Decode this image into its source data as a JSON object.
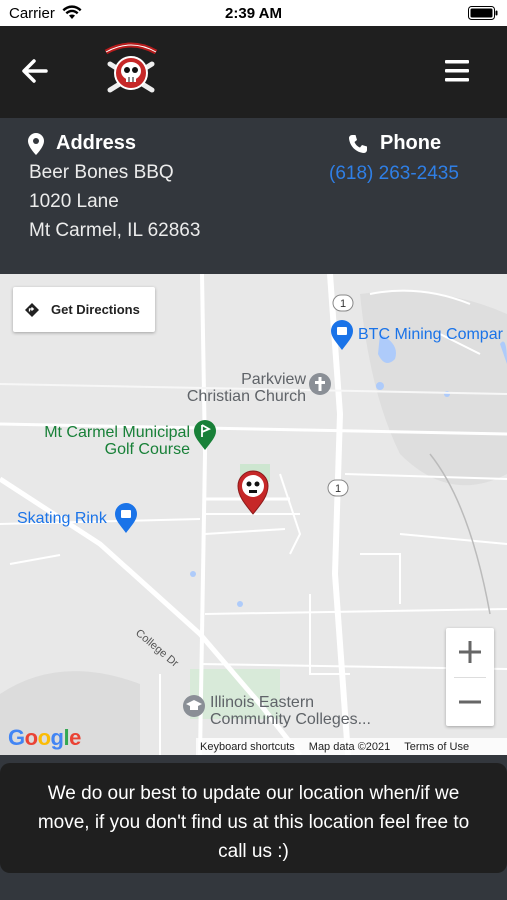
{
  "status_bar": {
    "carrier": "Carrier",
    "time": "2:39 AM",
    "icons": [
      "wifi-icon",
      "battery-icon"
    ]
  },
  "header": {
    "back_icon": "arrow-left-icon",
    "logo_alt": "Beer Bones BBQ logo",
    "menu_icon": "hamburger-menu-icon"
  },
  "address": {
    "label": "Address",
    "icon": "map-pin-icon",
    "lines": [
      "Beer Bones BBQ",
      "1020 Lane",
      "Mt Carmel, IL 62863"
    ]
  },
  "phone": {
    "label": "Phone",
    "icon": "phone-icon",
    "number": "(618) 263-2435",
    "link_color": "#2f7fe6"
  },
  "map": {
    "directions_label": "Get Directions",
    "pois": [
      {
        "name": "BTC Mining Compar",
        "color": "#1a73e8"
      },
      {
        "name": "Parkview\nChristian Church",
        "color": "#5f6368"
      },
      {
        "name": "Mt Carmel Municipal\nGolf Course",
        "color": "#188038"
      },
      {
        "name": "Skating Rink",
        "color": "#1a73e8"
      },
      {
        "name": "Illinois Eastern\nCommunity Colleges...",
        "color": "#5f6368"
      }
    ],
    "road_labels": [
      "College Dr",
      "1",
      "1"
    ],
    "zoom_in": "+",
    "zoom_out": "−",
    "google": "Google",
    "attribution": {
      "shortcuts": "Keyboard shortcuts",
      "data": "Map data ©2021",
      "terms": "Terms of Use"
    }
  },
  "notice": "We do our best to update our location when/if we move, if you don't find us at this location feel free to call us :)"
}
